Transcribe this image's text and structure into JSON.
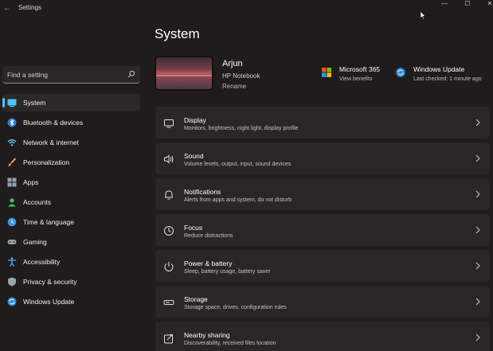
{
  "window": {
    "title": "Settings",
    "back_glyph": "←",
    "min_glyph": "—",
    "max_glyph": "☐",
    "close_glyph": "✕"
  },
  "search": {
    "placeholder": "Find a setting"
  },
  "sidebar": {
    "items": [
      {
        "label": "System",
        "icon": "system-icon",
        "active": true
      },
      {
        "label": "Bluetooth & devices",
        "icon": "bluetooth-icon"
      },
      {
        "label": "Network & internet",
        "icon": "wifi-icon"
      },
      {
        "label": "Personalization",
        "icon": "brush-icon"
      },
      {
        "label": "Apps",
        "icon": "apps-icon"
      },
      {
        "label": "Accounts",
        "icon": "accounts-icon"
      },
      {
        "label": "Time & language",
        "icon": "globe-clock-icon"
      },
      {
        "label": "Gaming",
        "icon": "gamepad-icon"
      },
      {
        "label": "Accessibility",
        "icon": "accessibility-icon"
      },
      {
        "label": "Privacy & security",
        "icon": "shield-icon"
      },
      {
        "label": "Windows Update",
        "icon": "update-icon"
      }
    ]
  },
  "main": {
    "title": "System",
    "device": {
      "name": "Arjun",
      "model": "HP Notebook",
      "rename": "Rename"
    },
    "microsoft365": {
      "title": "Microsoft 365",
      "subtitle": "View benefits"
    },
    "windows_update": {
      "title": "Windows Update",
      "subtitle": "Last checked: 1 minute ago"
    },
    "cards": [
      {
        "title": "Display",
        "subtitle": "Monitors, brightness, night light, display profile",
        "icon": "display-icon"
      },
      {
        "title": "Sound",
        "subtitle": "Volume levels, output, input, sound devices",
        "icon": "speaker-icon"
      },
      {
        "title": "Notifications",
        "subtitle": "Alerts from apps and system, do not disturb",
        "icon": "bell-icon"
      },
      {
        "title": "Focus",
        "subtitle": "Reduce distractions",
        "icon": "focus-icon"
      },
      {
        "title": "Power & battery",
        "subtitle": "Sleep, battery usage, battery saver",
        "icon": "power-icon"
      },
      {
        "title": "Storage",
        "subtitle": "Storage space, drives, configuration rules",
        "icon": "storage-icon"
      },
      {
        "title": "Nearby sharing",
        "subtitle": "Discoverability, received files location",
        "icon": "share-icon"
      }
    ]
  },
  "colors": {
    "background": "#211c1c",
    "card": "#2b2626",
    "accent": "#4cc2ff"
  }
}
